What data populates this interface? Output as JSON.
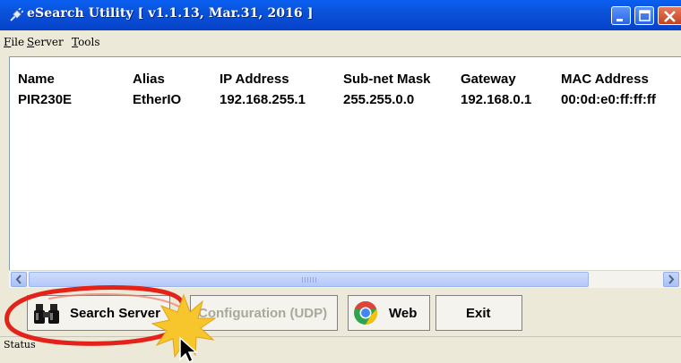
{
  "window": {
    "title": "eSearch Utility [ v1.1.13, Mar.31, 2016 ]"
  },
  "menu": [
    {
      "label": "File",
      "key": "F",
      "rest": "ile"
    },
    {
      "label": "Server",
      "key": "S",
      "rest": "erver"
    },
    {
      "label": "Tools",
      "key": "T",
      "rest": "ools"
    }
  ],
  "table": {
    "columns": [
      "Name",
      "Alias",
      "IP Address",
      "Sub-net Mask",
      "Gateway",
      "MAC Address"
    ],
    "rows": [
      [
        "PIR230E",
        "EtherIO",
        "192.168.255.1",
        "255.255.0.0",
        "192.168.0.1",
        "00:0d:e0:ff:ff:ff"
      ]
    ]
  },
  "buttons": {
    "search": "Search Server",
    "configuration": "Configuration (UDP)",
    "web": "Web",
    "exit": "Exit"
  },
  "status": {
    "text": "Status"
  },
  "icons": {
    "title": "plug-icon",
    "search": "binoculars-icon",
    "web": "chrome-icon"
  },
  "colors": {
    "titlebar": "#0a52d9",
    "highlight_circle": "#e32219",
    "burst": "#f7c52c"
  }
}
